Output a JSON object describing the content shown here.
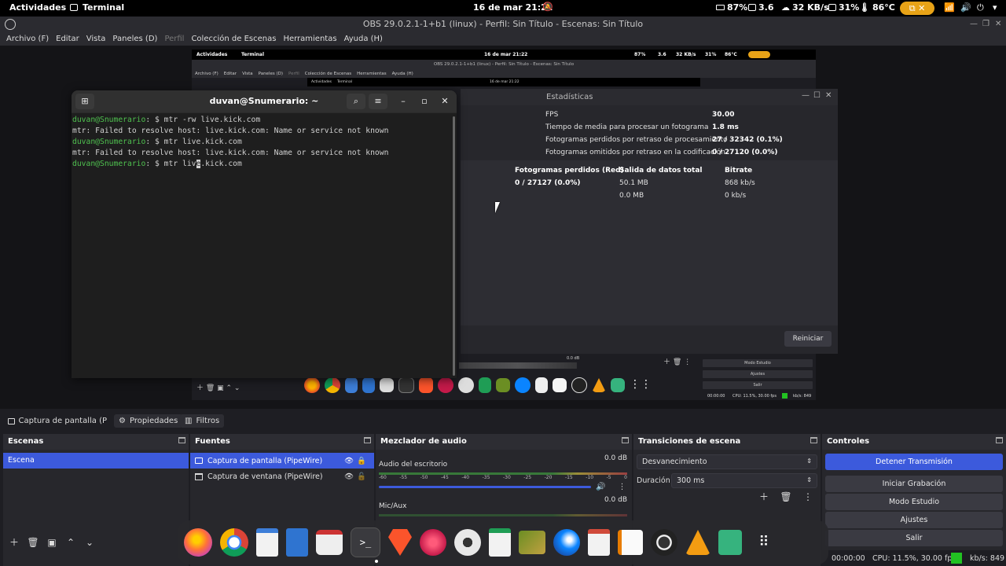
{
  "topbar": {
    "activities": "Actividades",
    "app_name": "Terminal",
    "clock": "16 de mar  21:22",
    "battery": "87%",
    "load": "3.6",
    "network": "32 KB/s",
    "cpu": "31%",
    "temperature": "86°C"
  },
  "obs": {
    "title": "OBS 29.0.2.1-1+b1 (linux) - Perfil: Sin Título - Escenas: Sin Título",
    "menu": [
      "Archivo (F)",
      "Editar",
      "Vista",
      "Paneles (D)",
      "Perfil",
      "Colección de Escenas",
      "Herramientas",
      "Ayuda (H)"
    ]
  },
  "nested": {
    "activities": "Actividades",
    "app_name": "Terminal",
    "clock": "16 de mar 21:22",
    "battery": "87%",
    "load": "3.6",
    "network": "32 KB/s",
    "cpu": "31%",
    "temperature": "86°C",
    "title": "OBS 29.0.2.1-1+b1 (linux) - Perfil: Sin Título - Escenas: Sin Título",
    "menu": [
      "Archivo (F)",
      "Editar",
      "Vista",
      "Paneles (D)",
      "Perfil",
      "Colección de Escenas",
      "Herramientas",
      "Ayuda (H)"
    ],
    "inner_activities": "Actividades",
    "inner_app": "Terminal",
    "inner_clock": "16 de mar 21:22",
    "controls": [
      "Modo Estudio",
      "Ajustes",
      "Salir"
    ],
    "db": "0.0 dB",
    "status": "00:00:00",
    "cpu_fps": "CPU: 11.5%, 30.00 fps",
    "kbs": "kb/s: 849"
  },
  "stats": {
    "title": "Estadísticas",
    "rows": [
      {
        "label": "FPS",
        "value": "30.00"
      },
      {
        "label": "Tiempo de media para procesar un fotograma",
        "value": "1.8 ms"
      },
      {
        "label": "Fotogramas perdidos por retraso de procesamiento",
        "value": "27 / 32342 (0.1%)"
      },
      {
        "label": "Fotogramas omitidos por retraso en la codificación",
        "value": "0 / 27120 (0.0%)"
      }
    ],
    "columns": [
      "Fotogramas perdidos (Red)",
      "Salida de datos total",
      "Bitrate"
    ],
    "table_rows": [
      [
        "0 / 27127 (0.0%)",
        "50.1 MB",
        "868 kb/s"
      ],
      [
        "",
        "0.0 MB",
        "0 kb/s"
      ]
    ],
    "reset": "Reiniciar"
  },
  "terminal": {
    "title": "duvan@Snumerario: ~",
    "prompt": "duvan@Snumerario",
    "prompt_suffix": ": $ ",
    "lines": [
      {
        "cmd": "mtr -rw live.kick.com"
      },
      {
        "out": "mtr: Failed to resolve host: live.kick.com: Name or service not known"
      },
      {
        "cmd": "mtr live.kick.com"
      },
      {
        "out": "mtr: Failed to resolve host: live.kick.com: Name or service not known"
      }
    ],
    "current_cmd_before": "mtr liv",
    "current_cmd_cursor": "e",
    "current_cmd_after": ".kick.com"
  },
  "propbar": {
    "source": "Captura de pantalla (PipeW",
    "properties": "Propiedades",
    "filters": "Filtros"
  },
  "scenes": {
    "title": "Escenas",
    "items": [
      "Escena"
    ]
  },
  "sources": {
    "title": "Fuentes",
    "items": [
      "Captura de pantalla (PipeWire)",
      "Captura de ventana (PipeWire)"
    ]
  },
  "mixer": {
    "title": "Mezclador de audio",
    "channels": [
      {
        "name": "Audio del escritorio",
        "db": "0.0 dB"
      },
      {
        "name": "Mic/Aux",
        "db": "0.0 dB"
      }
    ],
    "ticks": [
      "-60",
      "-55",
      "-50",
      "-45",
      "-40",
      "-35",
      "-30",
      "-25",
      "-20",
      "-15",
      "-10",
      "-5",
      "0"
    ]
  },
  "transitions": {
    "title": "Transiciones de escena",
    "selected": "Desvanecimiento",
    "duration_label": "Duración",
    "duration_value": "300 ms"
  },
  "controls": {
    "title": "Controles",
    "buttons": [
      "Detener Transmisión",
      "Iniciar Grabación",
      "Modo Estudio",
      "Ajustes",
      "Salir"
    ]
  },
  "status": {
    "time": "00:00:00",
    "cpu_fps": "CPU: 11.5%, 30.00 fps",
    "kbs": "kb/s: 849"
  },
  "dock_apps": [
    "firefox-icon",
    "chrome-icon",
    "writer-icon",
    "files-icon",
    "software-icon",
    "terminal-icon",
    "brave-icon",
    "raspberry-icon",
    "settings-icon",
    "calc-icon",
    "kleopatra-icon",
    "thunderbird-icon",
    "presentation-icon",
    "text-editor-icon",
    "obs-icon",
    "vlc-icon",
    "recycle-icon",
    "app-grid-icon"
  ]
}
